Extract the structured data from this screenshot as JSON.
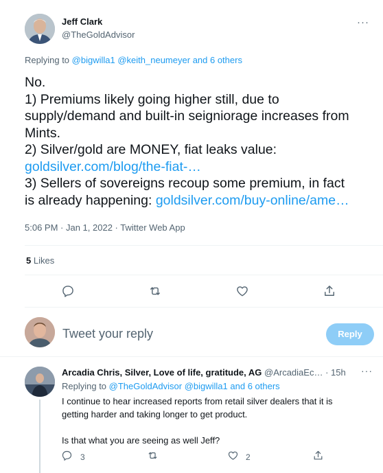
{
  "tweet": {
    "author_name": "Jeff Clark",
    "author_handle": "@TheGoldAdvisor",
    "replying_label": "Replying to",
    "replying_to": [
      "@bigwilla1",
      "@keith_neumeyer"
    ],
    "replying_others": "and 6 others",
    "body": {
      "line1": "No.",
      "line2": "1) Premiums likely going higher still, due to",
      "line3": "supply/demand and built-in seigniorage increases from",
      "line4": "Mints.",
      "line5": "2) Silver/gold are MONEY, fiat leaks value:",
      "link1": "goldsilver.com/blog/the-fiat-…",
      "line7": "3) Sellers of sovereigns recoup some premium, in fact",
      "line8": "is already happening:",
      "link2": "goldsilver.com/buy-online/ame…"
    },
    "time": "5:06 PM",
    "date": "Jan 1, 2022",
    "source": "Twitter Web App",
    "likes_count": "5",
    "likes_label": "Likes"
  },
  "compose": {
    "placeholder": "Tweet your reply",
    "button_label": "Reply"
  },
  "reply": {
    "author_name": "Arcadia Chris, Silver, Love of life, gratitude, AG",
    "author_handle": "@ArcadiaEc…",
    "age": "15h",
    "replying_label": "Replying to",
    "replying_to": [
      "@TheGoldAdvisor",
      "@bigwilla1"
    ],
    "replying_others": "and 6 others",
    "body_line1": "I continue to hear increased reports from retail silver dealers that it is",
    "body_line2": "getting harder and taking longer to get product.",
    "body_line3": "Is that what you are seeing as well Jeff?",
    "reply_count": "3",
    "like_count": "2"
  },
  "icons": {
    "more": "more-dots-icon",
    "reply": "reply-bubble-icon",
    "retweet": "retweet-icon",
    "like": "heart-icon",
    "share": "share-icon"
  },
  "colors": {
    "link": "#1d9bf0",
    "secondary_text": "#536471",
    "reply_button_disabled": "#8ecdf7"
  }
}
